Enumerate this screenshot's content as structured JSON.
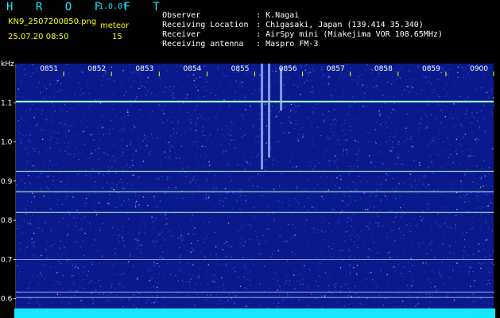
{
  "header": {
    "brand": "H R O F F T",
    "version": "1.0.0f",
    "filename": "KN9_2507200850.png",
    "timestamp": "25.07.20 08:50",
    "meteor_label": "meteor",
    "meteor_count": "15",
    "metadata": [
      {
        "key": "Observer",
        "value": ": K.Nagai"
      },
      {
        "key": "Receiving Location",
        "value": ": Chigasaki, Japan (139.414 35.340)"
      },
      {
        "key": "Receiver",
        "value": ": AirSpy mini (Miakejima VOR 108.65MHz)"
      },
      {
        "key": "Receiving antenna",
        "value": ": Maspro FM-3"
      }
    ]
  },
  "colors": {
    "background": "#000000",
    "spectrogram_base": "#0a1a8c",
    "noise_dot": "#3a5cff",
    "signal_line": "#a8ffcf",
    "header_cyan": "#19e6ff",
    "header_yellow": "#ffff00",
    "bottom_band": "#19e6ff"
  },
  "chart_data": {
    "type": "heatmap",
    "ylabel": "kHz",
    "y_ticks": [
      "1.1",
      "1.0",
      "0.9",
      "0.8",
      "0.7",
      "0.6"
    ],
    "y_tick_values": [
      1.1,
      1.0,
      0.9,
      0.8,
      0.7,
      0.6
    ],
    "ylim": [
      0.575,
      1.2
    ],
    "x_ticks": [
      "0851",
      "0852",
      "0853",
      "0854",
      "0855",
      "0856",
      "0857",
      "0858",
      "0859",
      "0900"
    ],
    "x_tick_minutes": [
      1,
      2,
      3,
      4,
      5,
      6,
      7,
      8,
      9,
      10
    ],
    "xlim_minutes": [
      0,
      10
    ],
    "horizontal_signals_khz": [
      1.103,
      0.925,
      0.873,
      0.82,
      0.7,
      0.617,
      0.603
    ],
    "meteor_echo_minutes": [
      5.15,
      5.3,
      5.55
    ],
    "grid": false
  }
}
